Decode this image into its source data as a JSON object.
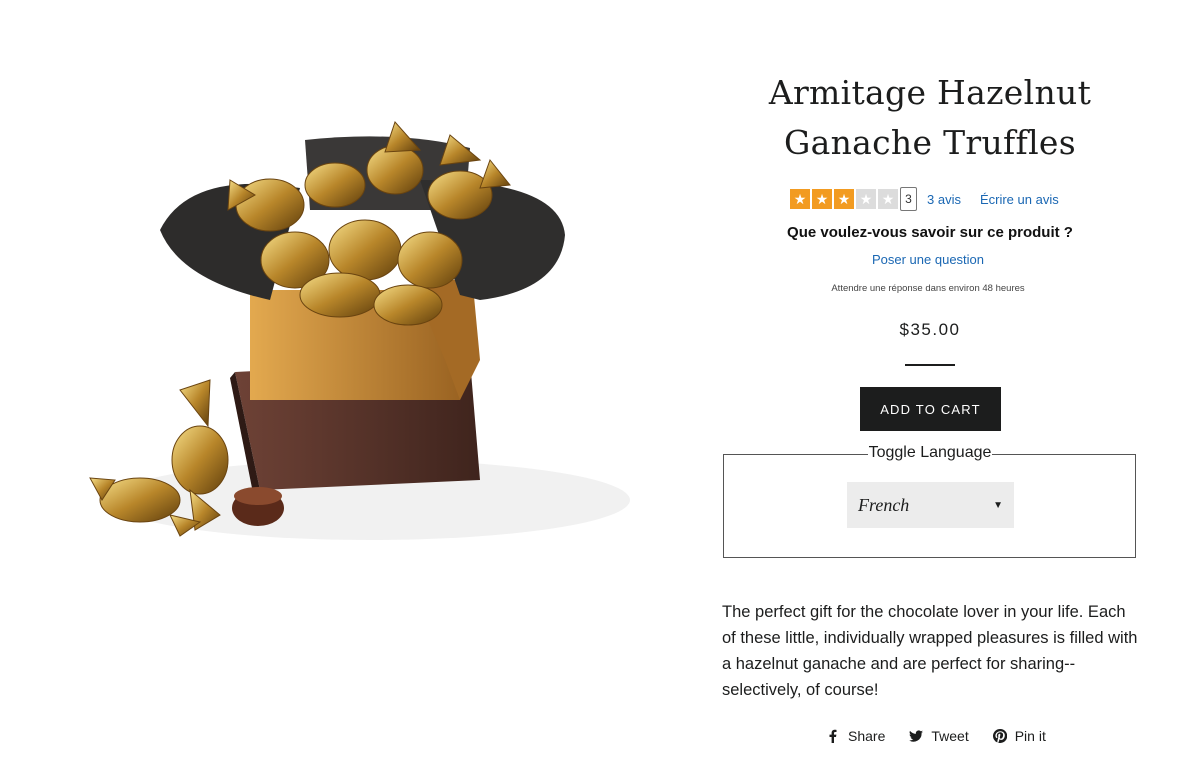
{
  "product": {
    "title_line1": "Armitage Hazelnut",
    "title_line2": "Ganache Truffles",
    "price": "$35.00",
    "description": "The perfect gift for the chocolate lover in your life. Each of these little, individually wrapped pleasures is filled with a hazelnut ganache and are perfect for sharing--selectively, of course!",
    "image_icon": "truffle-box-image"
  },
  "reviews": {
    "rating": 3,
    "max_rating": 5,
    "count_badge": "3",
    "count_label": "3 avis",
    "write_label": "Écrire un avis",
    "star_color": "#f29b21"
  },
  "questions": {
    "heading": "Que voulez-vous savoir sur ce produit ?",
    "ask_label": "Poser une question",
    "wait_note": "Attendre une réponse dans environ 48 heures"
  },
  "cart": {
    "add_label": "ADD TO CART"
  },
  "language": {
    "legend": "Toggle Language",
    "selected": "French"
  },
  "share": {
    "facebook_label": "Share",
    "twitter_label": "Tweet",
    "pinterest_label": "Pin it"
  }
}
